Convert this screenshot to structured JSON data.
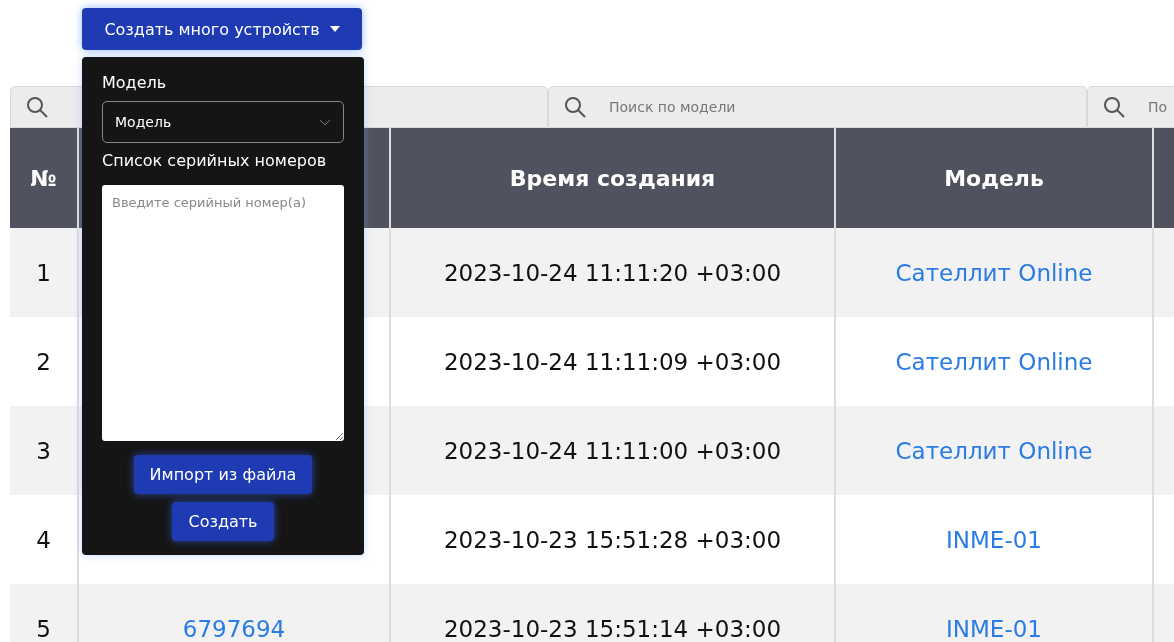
{
  "create_button": {
    "label": "Создать много устройств",
    "expanded": true
  },
  "dropdown": {
    "model_label": "Модель",
    "model_select": "Модель",
    "serials_label": "Список серийных номеров",
    "serials_placeholder": "Введите серийный номер(а)",
    "import_button": "Импорт из файла",
    "create_button": "Создать"
  },
  "search_fields": [
    {
      "kind": "search"
    },
    {
      "kind": "search",
      "placeholder": "Поиск по модели"
    },
    {
      "kind": "search",
      "placeholder": "По"
    }
  ],
  "table": {
    "columns": [
      "№",
      null,
      "Время создания",
      "Модель",
      null
    ],
    "rows": [
      {
        "number": "1",
        "created": "2023-10-24 11:11:20 +03:00",
        "model": "Сателлит Online"
      },
      {
        "number": "2",
        "created": "2023-10-24 11:11:09 +03:00",
        "model": "Сателлит Online"
      },
      {
        "number": "3",
        "created": "2023-10-24 11:11:00 +03:00",
        "model": "Сателлит Online"
      },
      {
        "number": "4",
        "created": "2023-10-23 15:51:28 +03:00",
        "model": "INME-01"
      },
      {
        "number": "5",
        "serial": "6797694",
        "created": "2023-10-23 15:51:14 +03:00",
        "model": "INME-01"
      }
    ]
  }
}
